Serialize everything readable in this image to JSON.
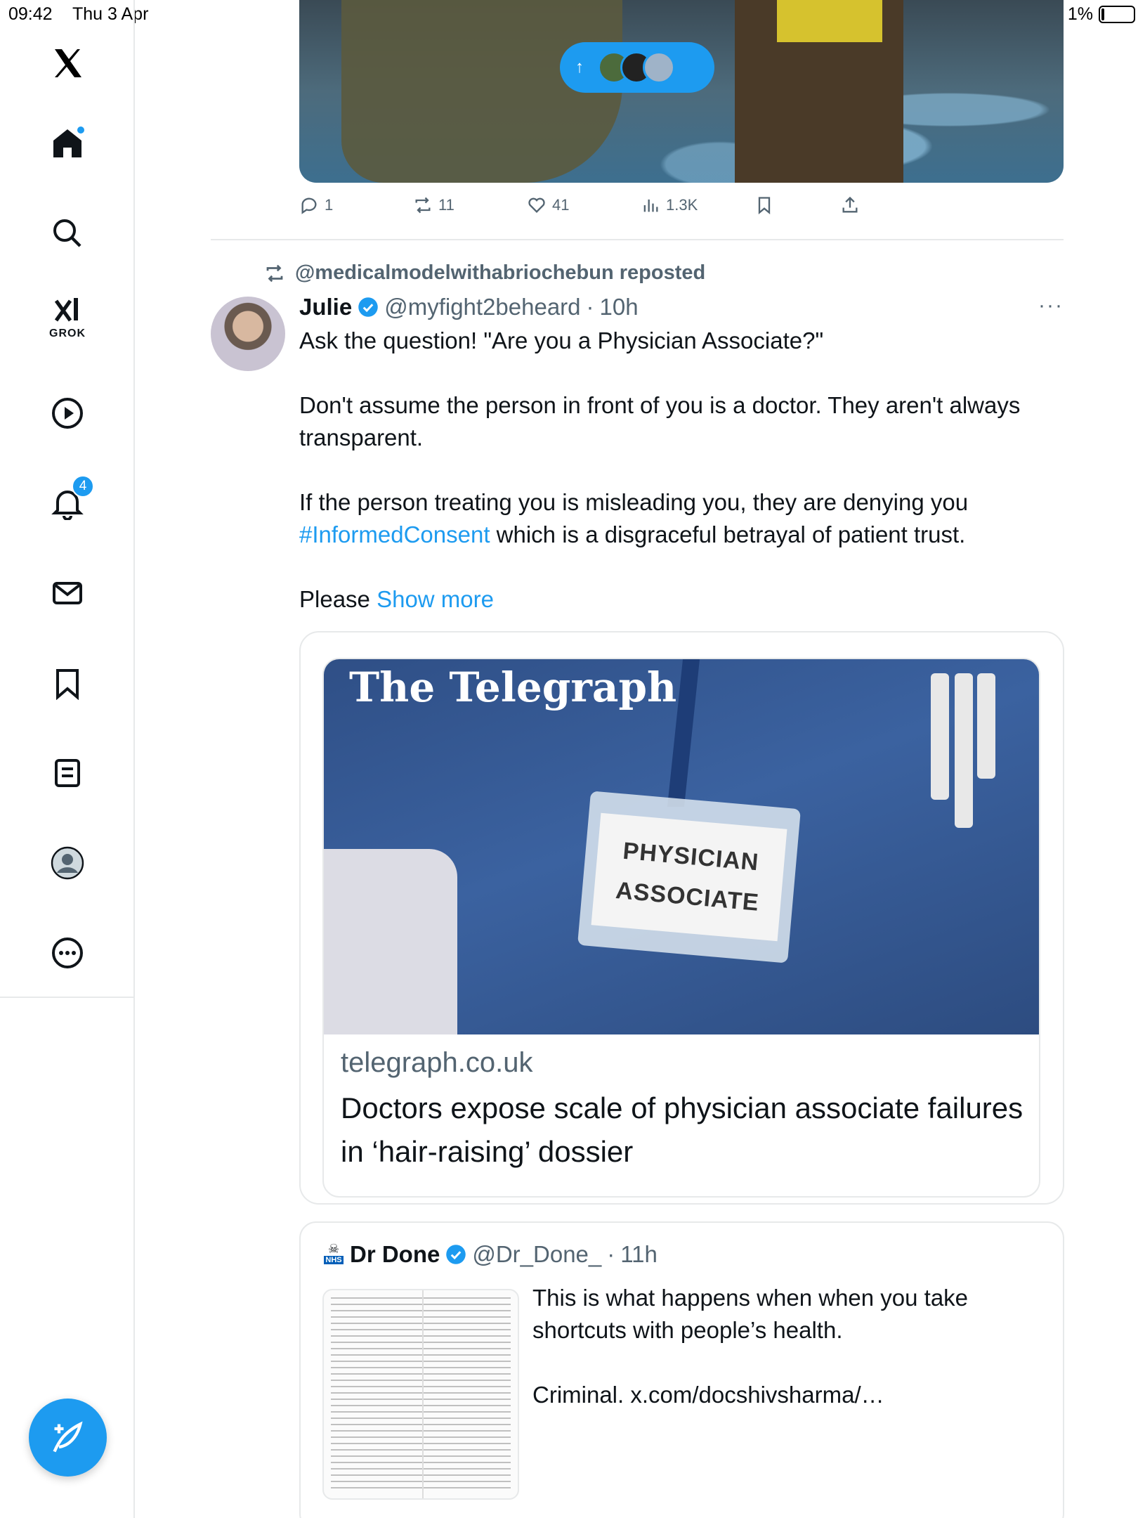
{
  "status_bar": {
    "time": "09:42",
    "date": "Thu 3 Apr",
    "battery": "1%"
  },
  "sidebar": {
    "items": [
      {
        "icon": "x-logo-icon"
      },
      {
        "icon": "home-icon",
        "has_dot": true
      },
      {
        "icon": "search-icon"
      },
      {
        "icon": "grok-icon",
        "label": "GROK"
      },
      {
        "icon": "video-icon"
      },
      {
        "icon": "notifications-icon",
        "badge": "4"
      },
      {
        "icon": "messages-icon"
      },
      {
        "icon": "bookmarks-icon"
      },
      {
        "icon": "lists-icon"
      },
      {
        "icon": "profile-icon"
      },
      {
        "icon": "more-icon"
      }
    ],
    "compose_icon": "compose-icon"
  },
  "previous_tweet": {
    "actions": {
      "replies": "1",
      "reposts": "11",
      "likes": "41",
      "views": "1.3K"
    }
  },
  "tweet": {
    "repost_label": "@medicalmodelwithabriochebun reposted",
    "author_name": "Julie",
    "author_handle": "@myfight2beheard",
    "time": "10h",
    "dot": "·",
    "paragraph1": "Ask the question! \"Are you a Physician Associate?\"",
    "paragraph2": "Don't assume the person in front of you is a doctor. They aren't always transparent.",
    "paragraph3_before": "If the person treating you is misleading you, they are denying you ",
    "hashtag": "#InformedConsent",
    "paragraph3_after": " which is a disgraceful betrayal of patient trust.",
    "please": "Please ",
    "show_more": "Show more",
    "card": {
      "masthead": "The Telegraph",
      "badge_line1": "PHYSICIAN",
      "badge_line2": "ASSOCIATE",
      "domain": "telegraph.co.uk",
      "title": "Doctors expose scale of physician associate failures in ‘hair-raising’ dossier"
    }
  },
  "quote": {
    "nhs_tag": "NHS",
    "author_name": "Dr Done",
    "author_handle": "@Dr_Done_",
    "dot": "·",
    "time": "11h",
    "paragraph1": "This is what happens when when you take shortcuts with people’s health.",
    "paragraph2": "Criminal. x.com/docshivsharma/…"
  },
  "colors": {
    "accent": "#1d9bf0",
    "text": "#0f1419",
    "muted": "#536471",
    "border": "#e7e9ea"
  }
}
